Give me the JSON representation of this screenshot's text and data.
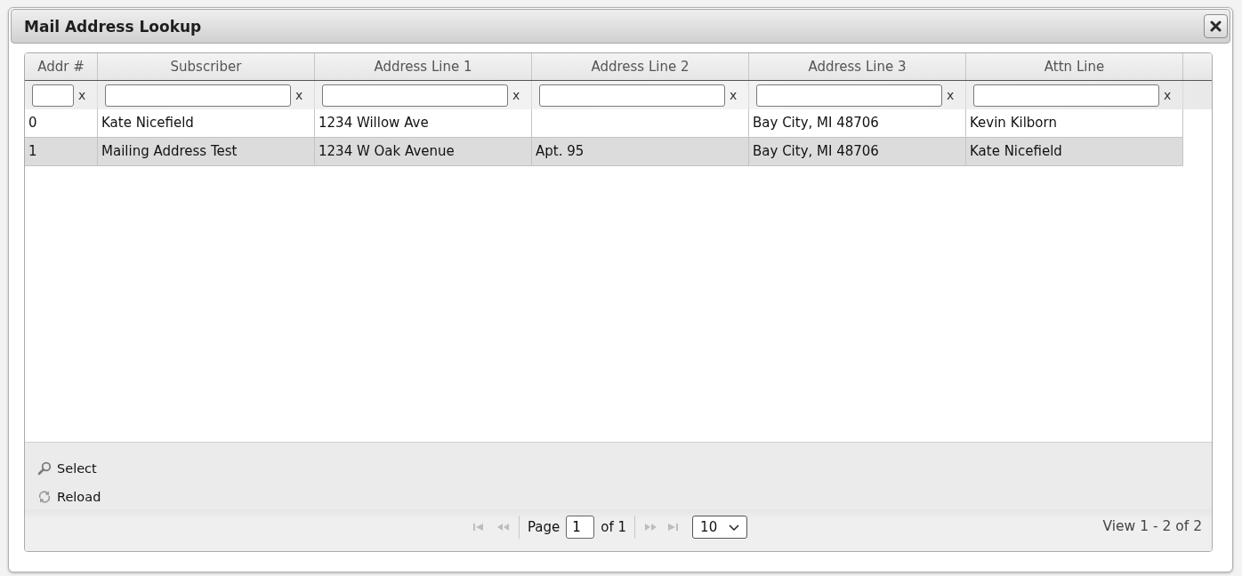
{
  "dialog": {
    "title": "Mail Address Lookup"
  },
  "table": {
    "columns": [
      {
        "label": "Addr #",
        "filter_clear": "x"
      },
      {
        "label": "Subscriber",
        "filter_clear": "x"
      },
      {
        "label": "Address Line 1",
        "filter_clear": "x"
      },
      {
        "label": "Address Line 2",
        "filter_clear": "x"
      },
      {
        "label": "Address Line 3",
        "filter_clear": "x"
      },
      {
        "label": "Attn Line",
        "filter_clear": "x"
      }
    ],
    "rows": [
      {
        "selected": false,
        "cells": [
          "0",
          "Kate Nicefield",
          "1234 Willow Ave",
          null,
          "Bay City, MI 48706",
          "Kevin Kilborn"
        ]
      },
      {
        "selected": true,
        "cells": [
          "1",
          "Mailing Address Test",
          "1234 W Oak Avenue",
          "Apt. 95",
          "Bay City, MI 48706",
          "Kate Nicefield"
        ]
      }
    ]
  },
  "toolbar": {
    "actions": [
      {
        "kind": "select",
        "label": "Select"
      },
      {
        "kind": "reload",
        "label": "Reload"
      }
    ]
  },
  "pager": {
    "nav_back": [
      {
        "kind": "first",
        "disabled": true
      },
      {
        "kind": "prev",
        "disabled": true
      }
    ],
    "page_label": "Page",
    "page": "1",
    "total_label": "of 1",
    "nav_forward": [
      {
        "kind": "next",
        "disabled": true
      },
      {
        "kind": "last",
        "disabled": true
      }
    ],
    "page_size": "10",
    "summary": "View 1 - 2 of 2"
  }
}
